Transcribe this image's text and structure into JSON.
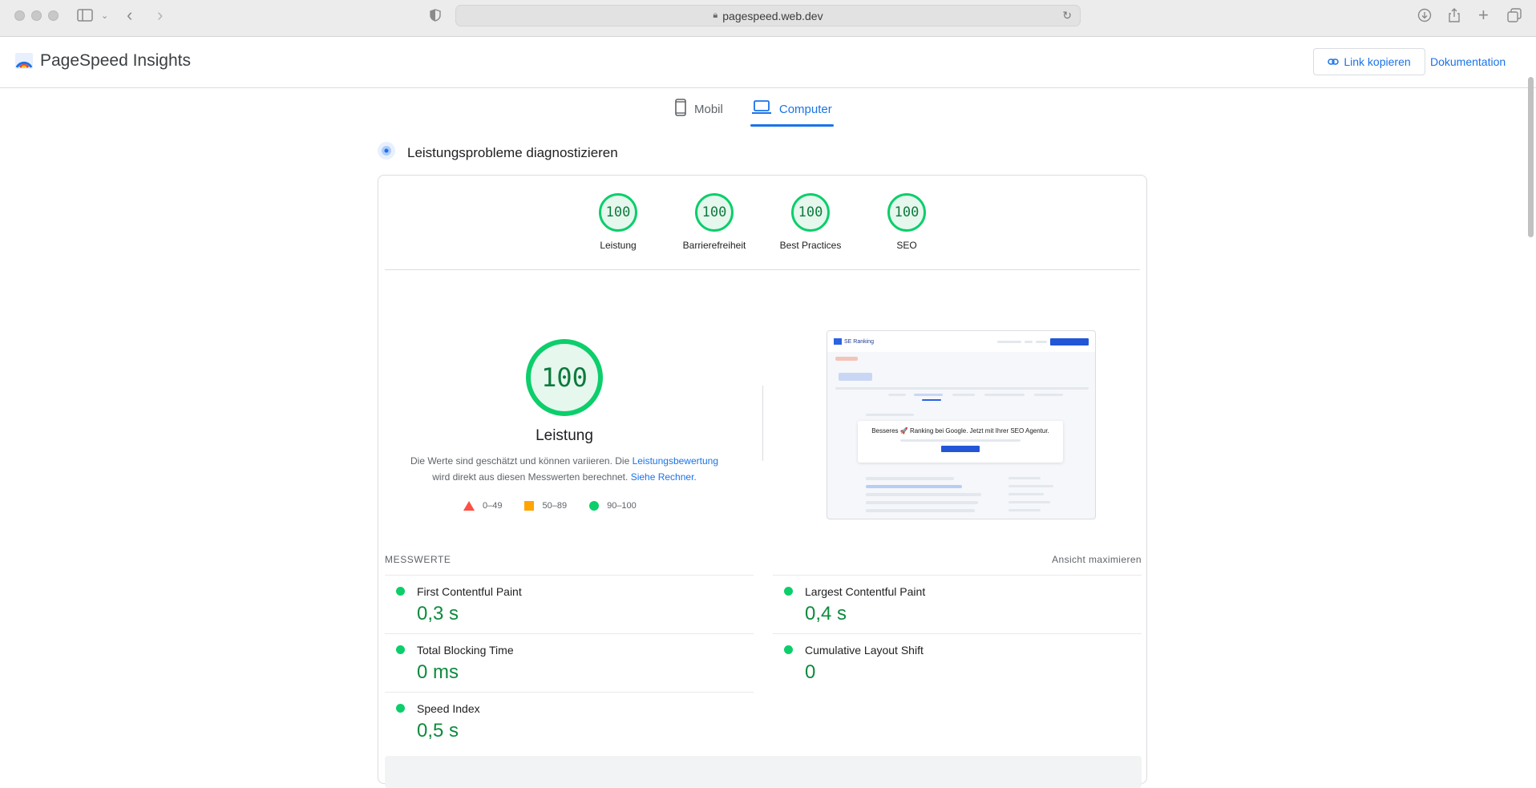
{
  "browser": {
    "url": "pagespeed.web.dev"
  },
  "header": {
    "app_title": "PageSpeed Insights",
    "copy_link_label": "Link kopieren",
    "docs_label": "Dokumentation"
  },
  "tabs": [
    {
      "label": "Mobil",
      "icon": "phone-icon",
      "active": false
    },
    {
      "label": "Computer",
      "icon": "laptop-icon",
      "active": true
    }
  ],
  "diagnose_title": "Leistungsprobleme diagnostizieren",
  "gauges": [
    {
      "score": "100",
      "label": "Leistung"
    },
    {
      "score": "100",
      "label": "Barrierefreiheit"
    },
    {
      "score": "100",
      "label": "Best Practices"
    },
    {
      "score": "100",
      "label": "SEO"
    }
  ],
  "performance": {
    "score": "100",
    "label": "Leistung",
    "note_part1": "Die Werte sind geschätzt und können variieren. Die ",
    "note_link1": "Leistungsbewertung",
    "note_part2": "wird direkt aus diesen Messwerten berechnet. ",
    "note_link2": "Siehe Rechner."
  },
  "legend": [
    {
      "range": "0–49",
      "shape": "triangle",
      "color": "#ff4e42"
    },
    {
      "range": "50–89",
      "shape": "square",
      "color": "#ffa400"
    },
    {
      "range": "90–100",
      "shape": "circle",
      "color": "#0cce6b"
    }
  ],
  "screenshot": {
    "brand": "SE Ranking",
    "popup_title": "Besseres 🚀 Ranking bei Google. Jetzt mit Ihrer SEO Agentur."
  },
  "metrics": {
    "heading": "MESSWERTE",
    "toggle": "Ansicht maximieren",
    "items": [
      {
        "name": "First Contentful Paint",
        "value": "0,3 s"
      },
      {
        "name": "Largest Contentful Paint",
        "value": "0,4 s"
      },
      {
        "name": "Total Blocking Time",
        "value": "0 ms"
      },
      {
        "name": "Cumulative Layout Shift",
        "value": "0"
      },
      {
        "name": "Speed Index",
        "value": "0,5 s"
      }
    ]
  },
  "colors": {
    "accent": "#1a73e8",
    "pass": "#0cce6b",
    "pass_text": "#0d8a3e"
  }
}
